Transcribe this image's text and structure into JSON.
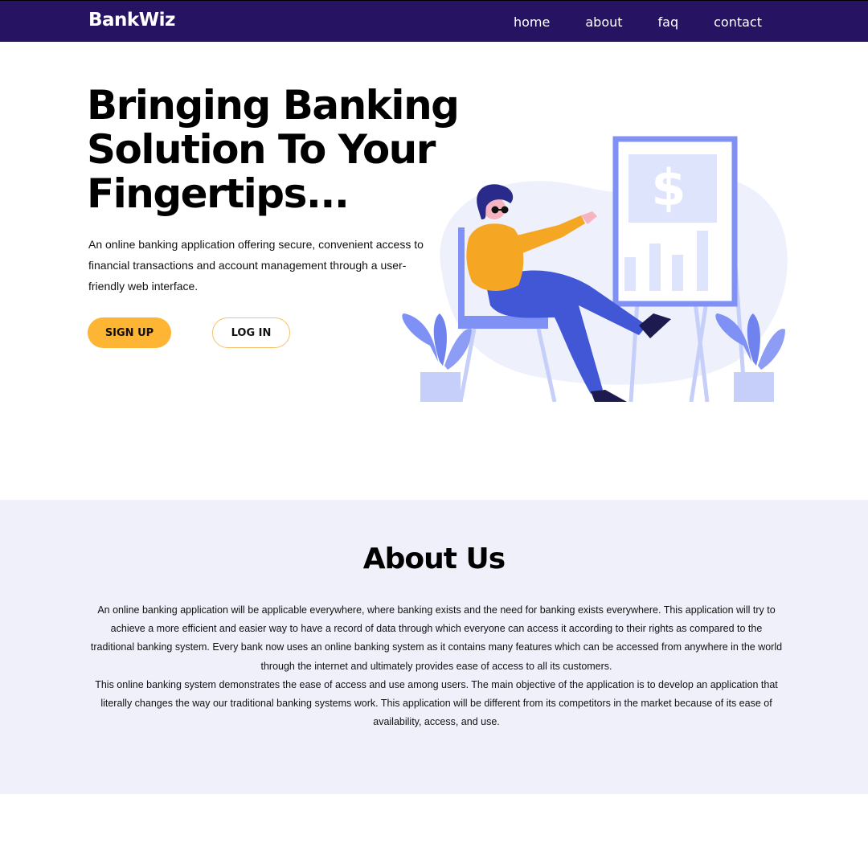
{
  "nav": {
    "brand": "BankWiz",
    "links": [
      "home",
      "about",
      "faq",
      "contact"
    ],
    "background": "#261463"
  },
  "hero": {
    "title": "Bringing Banking Solution To Your Fingertips...",
    "description": "An online banking application offering secure, convenient access to financial transactions and account management through a user-friendly web interface.",
    "signup_label": "SIGN UP",
    "login_label": "LOG IN",
    "accent": "#ffb534",
    "illustration_icon": "dollar-sign-icon"
  },
  "about": {
    "title": "About Us",
    "paragraph1": "An online banking application will be applicable everywhere, where banking exists and the need for banking exists everywhere. This application will try to achieve a more efficient and easier way to have a record of data through which everyone can access it according to their rights as compared to the traditional banking system. Every bank now uses an online banking system as it contains many features which can be accessed from anywhere in the world through the internet and ultimately provides ease of access to all its customers.",
    "paragraph2": "This online banking system demonstrates the ease of access and use among users. The main objective of the application is to develop an application that literally changes the way our traditional banking systems work. This application will be different from its competitors in the market because of its ease of availability, access, and use.",
    "background": "#f0f0fb"
  }
}
